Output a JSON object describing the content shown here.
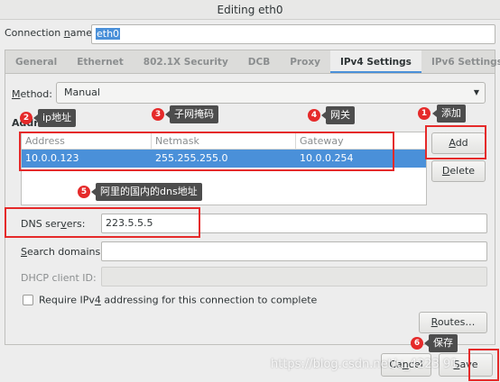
{
  "window": {
    "title": "Editing eth0"
  },
  "connection": {
    "label_pre": "Connection ",
    "label_mn": "n",
    "label_post": "ame:",
    "value": "eth0"
  },
  "tabs": [
    {
      "label": "General"
    },
    {
      "label": "Ethernet"
    },
    {
      "label": "802.1X Security"
    },
    {
      "label": "DCB"
    },
    {
      "label": "Proxy"
    },
    {
      "label": "IPv4 Settings",
      "active": true
    },
    {
      "label": "IPv6 Settings"
    }
  ],
  "method": {
    "label_mn": "M",
    "label_post": "ethod:",
    "value": "Manual",
    "arrow": "▼"
  },
  "addresses": {
    "label": "Addresses",
    "columns": [
      "Address",
      "Netmask",
      "Gateway"
    ],
    "rows": [
      {
        "address": "10.0.0.123",
        "netmask": "255.255.255.0",
        "gateway": "10.0.0.254"
      }
    ],
    "add_mn": "A",
    "add_post": "dd",
    "delete_mn": "D",
    "delete_post": "elete"
  },
  "dns": {
    "label_pre": "DNS ser",
    "label_mn": "v",
    "label_post": "ers:",
    "value": "223.5.5.5"
  },
  "search": {
    "label_mn": "S",
    "label_post": "earch domains:",
    "value": ""
  },
  "dhcp": {
    "label": "DHCP client ID:",
    "value": ""
  },
  "require": {
    "pre": "Require IPv",
    "mn": "4",
    "post": " addressing for this connection to complete",
    "checked": false
  },
  "routes": {
    "mn": "R",
    "post": "outes…"
  },
  "footer": {
    "cancel_pre": "Ca",
    "cancel_mn": "n",
    "cancel_post": "cel",
    "save_mn": "S",
    "save_post": "ave"
  },
  "annotations": [
    {
      "num": "1",
      "text": "添加"
    },
    {
      "num": "2",
      "text": "ip地址"
    },
    {
      "num": "3",
      "text": "子网掩码"
    },
    {
      "num": "4",
      "text": "网关"
    },
    {
      "num": "5",
      "text": "阿里的国内的dns地址"
    },
    {
      "num": "6",
      "text": "保存"
    }
  ],
  "watermark": "https://blog.csdn.net/u_4223 91",
  "colors": {
    "annotation_red": "#e52a2a",
    "selection_blue": "#4a90d9",
    "callout_bg": "#4d4d4d"
  }
}
